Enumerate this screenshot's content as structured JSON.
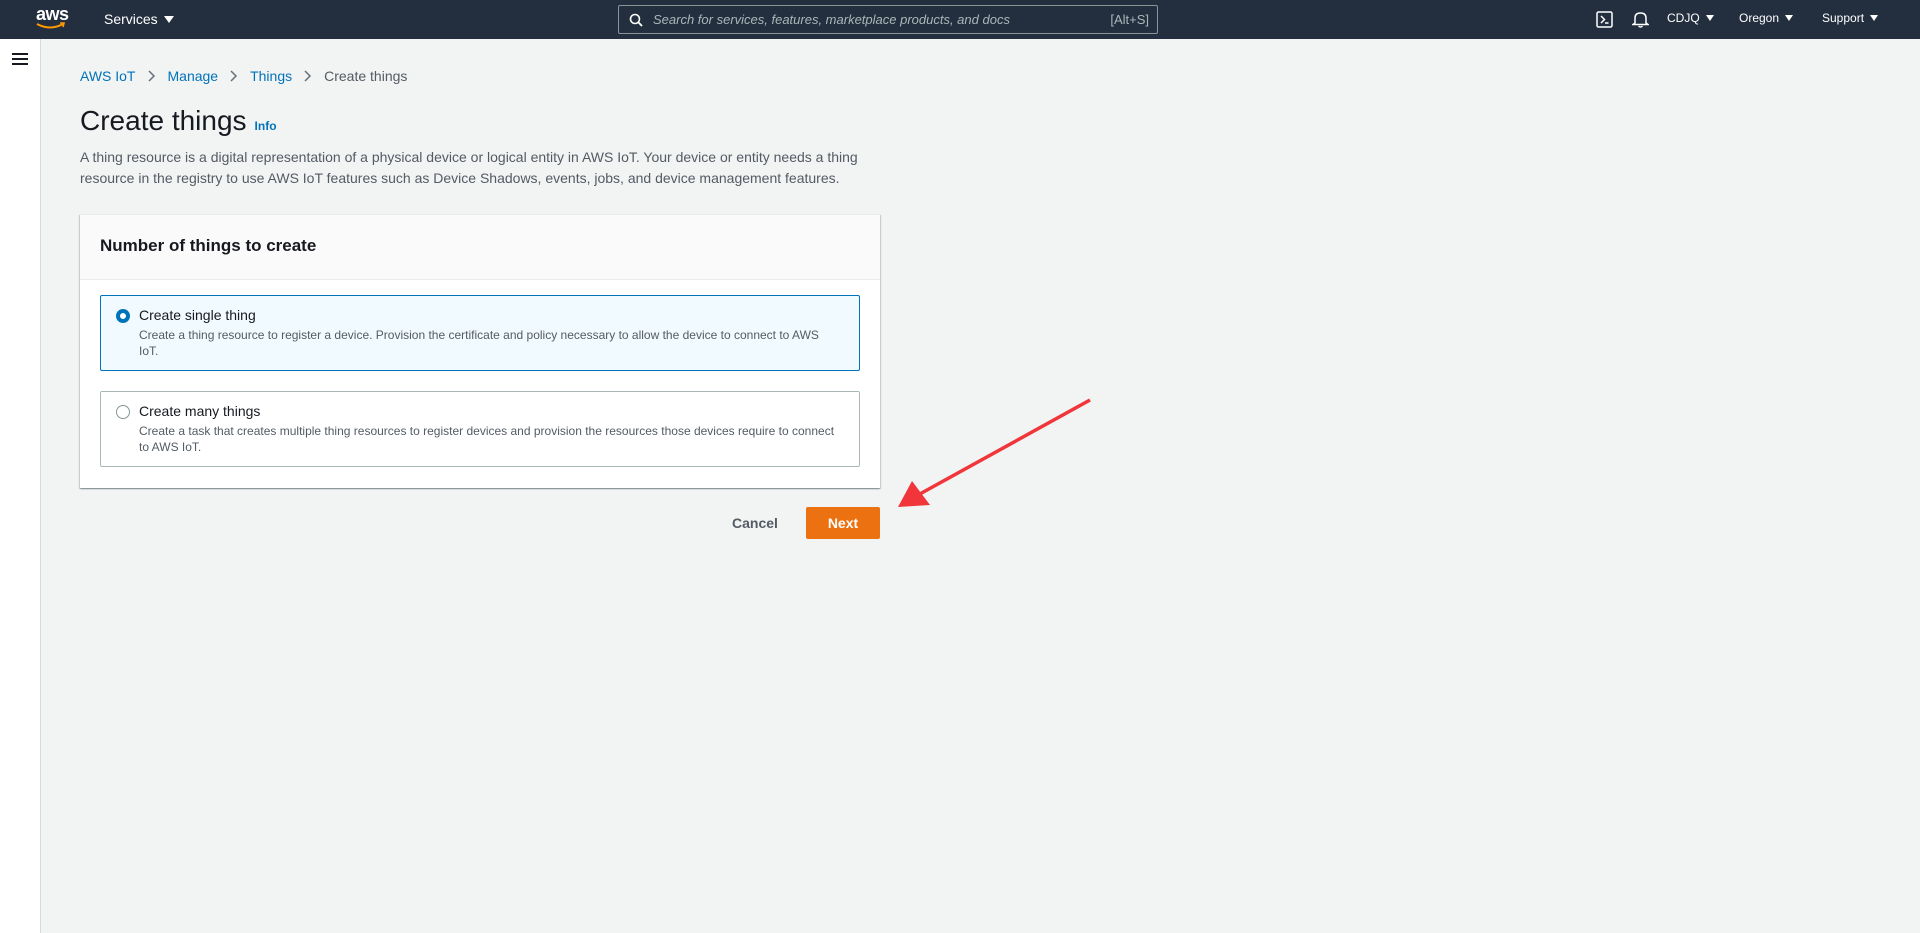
{
  "topnav": {
    "logo_text": "aws",
    "services_label": "Services",
    "search_placeholder": "Search for services, features, marketplace products, and docs",
    "search_shortcut": "[Alt+S]",
    "account_label": "CDJQ",
    "region_label": "Oregon",
    "support_label": "Support",
    "icons": [
      "cloudshell-icon",
      "bell-icon",
      "search-icon",
      "menu-icon"
    ]
  },
  "breadcrumb": {
    "items": [
      "AWS IoT",
      "Manage",
      "Things"
    ],
    "current": "Create things"
  },
  "page": {
    "title": "Create things",
    "info_label": "Info",
    "description": "A thing resource is a digital representation of a physical device or logical entity in AWS IoT. Your device or entity needs a thing resource in the registry to use AWS IoT features such as Device Shadows, events, jobs, and device management features."
  },
  "card": {
    "title": "Number of things to create",
    "options": [
      {
        "label": "Create single thing",
        "description": "Create a thing resource to register a device. Provision the certificate and policy necessary to allow the device to connect to AWS IoT.",
        "selected": true
      },
      {
        "label": "Create many things",
        "description": "Create a task that creates multiple thing resources to register devices and provision the resources those devices require to connect to AWS IoT.",
        "selected": false
      }
    ]
  },
  "actions": {
    "cancel_label": "Cancel",
    "next_label": "Next"
  },
  "colors": {
    "nav_bg": "#232f3e",
    "accent_blue": "#0073bb",
    "primary_orange": "#ec7211",
    "annotation_red": "#f0363a"
  }
}
